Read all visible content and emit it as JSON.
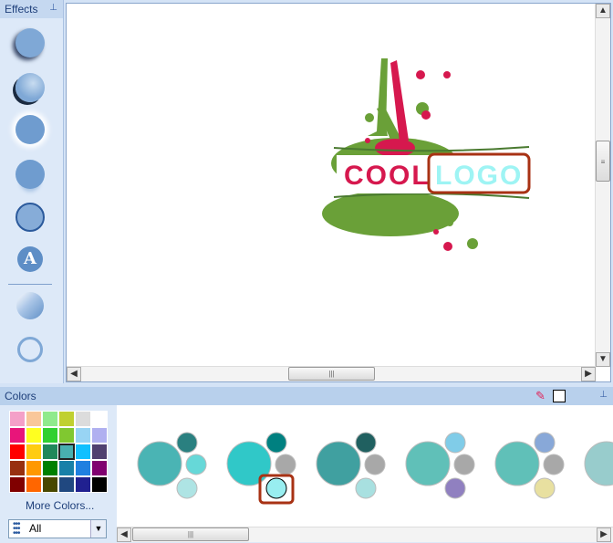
{
  "effects_panel": {
    "title": "Effects",
    "items": [
      "shadow",
      "bevel",
      "glow",
      "reflection",
      "outline",
      "text-effect",
      "gradient",
      "ring"
    ],
    "text_effect_glyph": "A"
  },
  "canvas": {
    "logo": {
      "word1": "COOL",
      "word2": "LOGO",
      "word1_color": "#d6184e",
      "word2_color": "#9ef4f4",
      "splash_colors": [
        "#6aa038",
        "#d6184e"
      ],
      "highlight_color": "#a83214"
    }
  },
  "colors_panel": {
    "title": "Colors",
    "palette": [
      [
        "#f4a0c8",
        "#f9c79a",
        "#90ea8c",
        "#c0d030",
        "#dcdcdc",
        "#ffffff"
      ],
      [
        "#e8157a",
        "#ffff20",
        "#30d030",
        "#80c830",
        "#98d4f4",
        "#b0b0f0"
      ],
      [
        "#ff0000",
        "#ffcc10",
        "#20885a",
        "#48b0b0",
        "#10c0ff",
        "#504070"
      ],
      [
        "#983010",
        "#ff9800",
        "#008000",
        "#1880a8",
        "#2080e0",
        "#800070"
      ],
      [
        "#800000",
        "#ff6600",
        "#484800",
        "#204880",
        "#202090",
        "#000000"
      ]
    ],
    "selected_swatch": "#48b0b0",
    "more_colors": "More Colors...",
    "filter": {
      "value": "All"
    },
    "current_color": "#ffffff",
    "color_sets": [
      [
        "#4ab4b4",
        "#2a8080",
        "#66d8d8",
        "#aee4e4"
      ],
      [
        "#30c8c8",
        "#008080",
        "#a8a8a8",
        "#98eef0"
      ],
      [
        "#40a0a0",
        "#206060",
        "#a8a8a8",
        "#a8e0e0"
      ],
      [
        "#60c0b8",
        "#80cce8",
        "#a8a8a8",
        "#9080c0"
      ],
      [
        "#60c0b8",
        "#88a8d8",
        "#a8a8a8",
        "#e8e0a0"
      ],
      [
        "#98cccc"
      ]
    ],
    "selected_set": 1,
    "selected_circle": 3
  }
}
